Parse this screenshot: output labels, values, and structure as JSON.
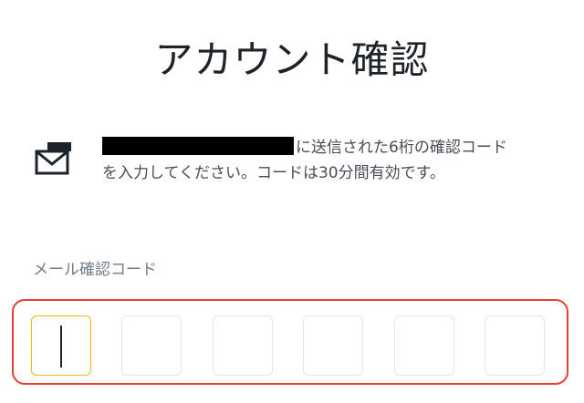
{
  "page": {
    "title": "アカウント確認"
  },
  "verification_message": {
    "email": "",
    "text_line1": "に送信された6桁の確認コード",
    "text_line2": "を入力してください。コードは30分間有効です。",
    "icon": "mail-icon"
  },
  "code_input": {
    "label": "メール確認コード",
    "digits": [
      "",
      "",
      "",
      "",
      "",
      ""
    ],
    "focused_index": 0,
    "highlight_color": "#e8402c",
    "focus_color": "#f0b90b"
  }
}
